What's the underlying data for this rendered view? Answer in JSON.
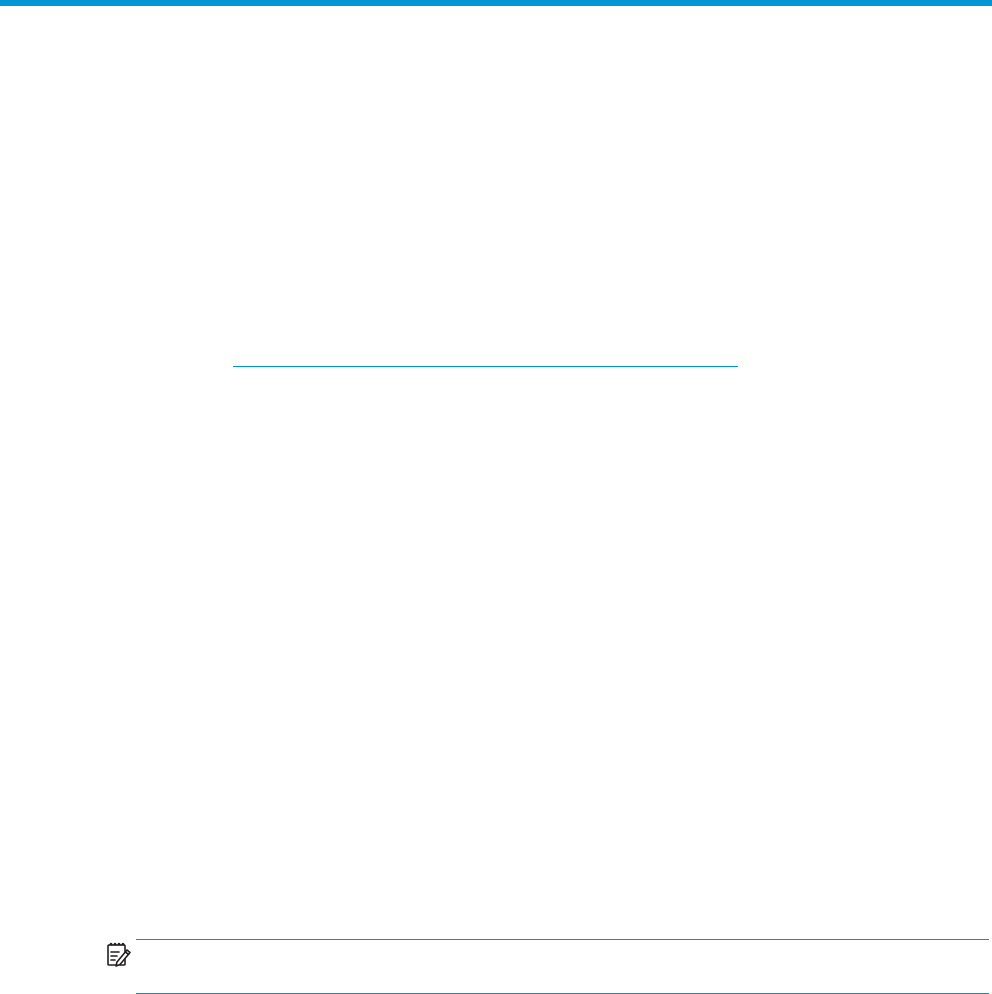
{
  "colors": {
    "accent": "#0096d6",
    "rule": "#0096d6",
    "icon_stroke": "#231f20"
  },
  "note": {
    "icon": "note-pad-pencil-icon"
  }
}
